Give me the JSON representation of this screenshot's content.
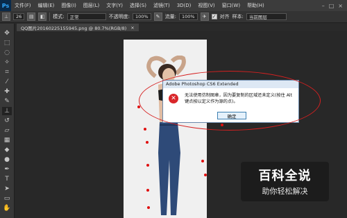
{
  "menubar": {
    "logo": "Ps",
    "items": [
      "文件(F)",
      "编辑(E)",
      "图像(I)",
      "图层(L)",
      "文字(Y)",
      "选择(S)",
      "滤镜(T)",
      "3D(D)",
      "视图(V)",
      "窗口(W)",
      "帮助(H)"
    ]
  },
  "optionsbar": {
    "brush_size": "26",
    "mode_label": "模式:",
    "mode_value": "正常",
    "opacity_label": "不透明度:",
    "opacity_value": "100%",
    "flow_label": "流量:",
    "flow_value": "100%",
    "aligned_label": "对齐",
    "sample_label": "样本:",
    "sample_value": "当前图层"
  },
  "document_tab": {
    "title": "QQ图片20160225155945.png @ 80.7%(RGB/8)",
    "close": "×"
  },
  "dialog": {
    "title": "Adobe Photoshop CS6 Extended",
    "message": "无法使用仿制图章，因为要复制的区域还未定义(按住 Alt 键点按以定义作为源的点)。",
    "ok_label": "确定"
  },
  "watermark": {
    "title": "百科全说",
    "subtitle": "助你轻松解决"
  },
  "colors": {
    "annotation_red": "#d62020",
    "error_icon": "#d9262a",
    "ps_blue": "#31a8ff"
  }
}
